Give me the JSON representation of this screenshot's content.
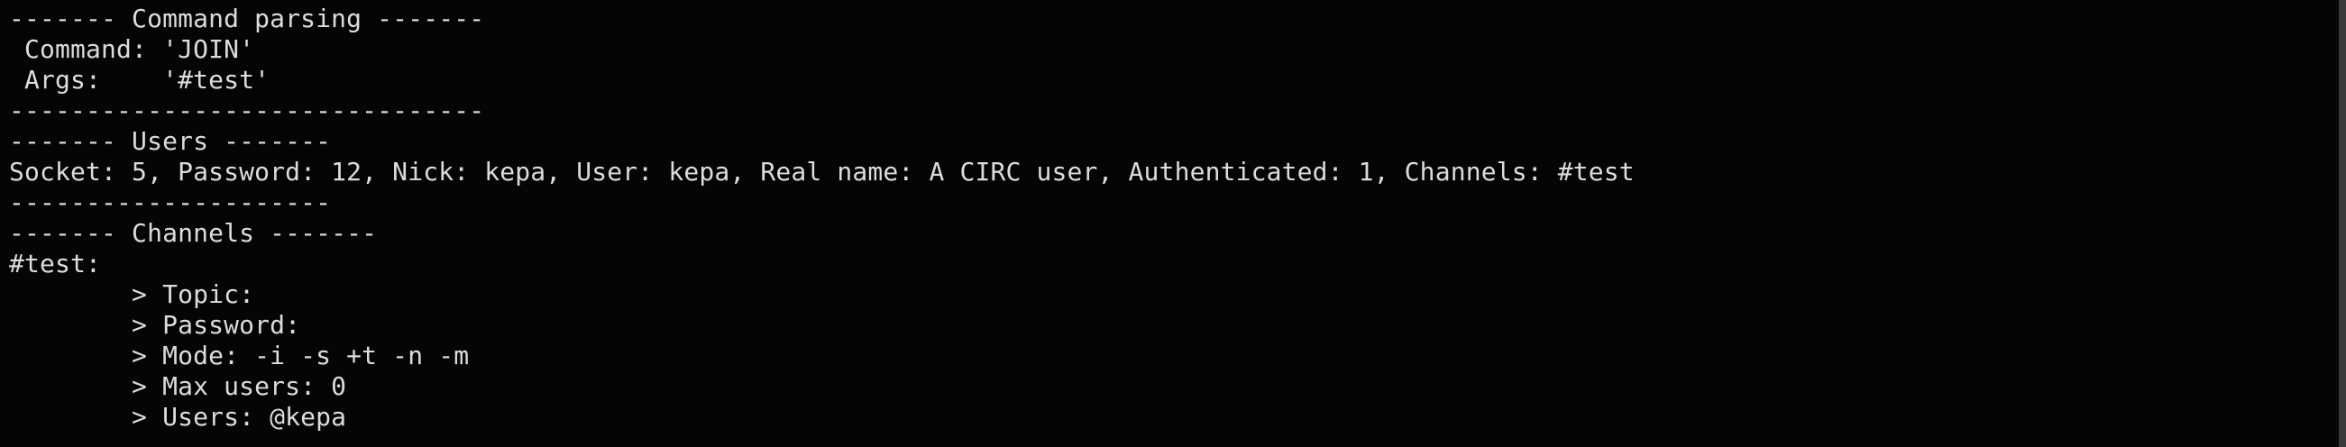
{
  "terminal": {
    "lines": [
      "------- Command parsing -------",
      " Command: 'JOIN'",
      " Args:    '#test'",
      "-------------------------------",
      "------- Users -------",
      "Socket: 5, Password: 12, Nick: kepa, User: kepa, Real name: A CIRC user, Authenticated: 1, Channels: #test",
      "---------------------",
      "------- Channels -------",
      "#test:",
      "        > Topic:",
      "        > Password:",
      "        > Mode: -i -s +t -n -m",
      "        > Max users: 0",
      "        > Users: @kepa"
    ]
  }
}
